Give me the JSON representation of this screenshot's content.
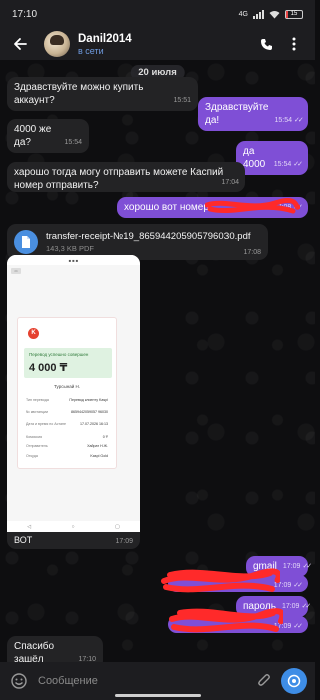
{
  "status_bar": {
    "time": "17:10",
    "battery": "15",
    "network": "4G"
  },
  "header": {
    "name": "Danil2014",
    "status": "в сети"
  },
  "date_separator": "20 июля",
  "messages": [
    {
      "text": "Здравствуйте можно купить аккаунт?",
      "time": "15:51",
      "dir": "in"
    },
    {
      "text": "Здравствуйте да!",
      "time": "15:54",
      "dir": "out"
    },
    {
      "text": "4000 же да?",
      "time": "15:54",
      "dir": "in"
    },
    {
      "text": "да 4000",
      "time": "15:54",
      "dir": "out"
    },
    {
      "text": "харошо тогда могу отправить можете Каспий номер отправить?",
      "time": "17:04",
      "dir": "in"
    },
    {
      "text": "хорошо вот номер",
      "time": "17:08",
      "dir": "out"
    },
    {
      "text": "gmail",
      "time": "17:09",
      "dir": "out"
    },
    {
      "text": "",
      "time": "17:09",
      "dir": "out"
    },
    {
      "text": "пароль",
      "time": "17:09",
      "dir": "out"
    },
    {
      "text": "",
      "time": "17:09",
      "dir": "out"
    },
    {
      "text": "Спасибо зашёл",
      "time": "17:10",
      "dir": "in"
    }
  ],
  "file": {
    "name": "transfer-receipt-№19_8659442059057960З0.pdf",
    "size": "143,3 KB PDF",
    "time": "17:08"
  },
  "photo": {
    "caption": "ВОТ",
    "time": "17:09",
    "receipt": {
      "logo": "K",
      "success_label": "Перевод успешно совершен",
      "amount": "4 000 ₸",
      "recipient": "Турсынай Н.",
      "rows": [
        {
          "label": "Тип перевода",
          "value": "Перевод клиенту Kaspi"
        },
        {
          "label": "№ квитанции",
          "value": "8659442059057 96030"
        },
        {
          "label": "Дата и время по Астане",
          "value": "17.07.2026 16:13"
        },
        {
          "label": "Комиссия",
          "value": "0 ₸"
        },
        {
          "label": "Отправитель",
          "value": "Хайрат Н.Ж."
        },
        {
          "label": "Откуда",
          "value": "Kaspi Gold"
        }
      ]
    }
  },
  "input": {
    "placeholder": "Сообщение"
  },
  "colors": {
    "outgoing": "#7f4fd6",
    "incoming": "#232325",
    "accent": "#3e8de6",
    "status_online": "#6f9be0"
  }
}
